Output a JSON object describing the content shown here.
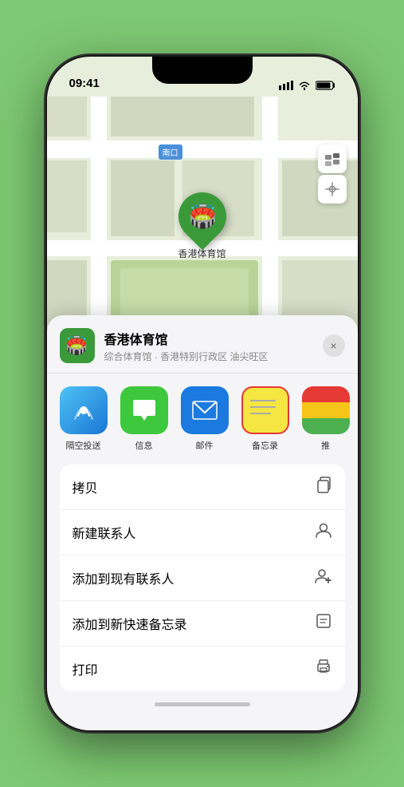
{
  "status_bar": {
    "time": "09:41",
    "signal_icon": "▌▌▌",
    "wifi_icon": "wifi",
    "battery_icon": "battery"
  },
  "map": {
    "label": "南口",
    "venue_name_on_map": "香港体育馆"
  },
  "sheet": {
    "venue_name": "香港体育馆",
    "venue_subtitle": "综合体育馆 · 香港特别行政区 油尖旺区",
    "close_label": "×"
  },
  "share_items": [
    {
      "id": "airdrop",
      "label": "隔空投送",
      "icon": "📡"
    },
    {
      "id": "messages",
      "label": "信息",
      "icon": "💬"
    },
    {
      "id": "mail",
      "label": "邮件",
      "icon": "✉️"
    },
    {
      "id": "notes",
      "label": "备忘录",
      "icon": "📝"
    },
    {
      "id": "more",
      "label": "推",
      "icon": "···"
    }
  ],
  "actions": [
    {
      "id": "copy",
      "label": "拷贝",
      "icon": "⎘"
    },
    {
      "id": "new-contact",
      "label": "新建联系人",
      "icon": "👤"
    },
    {
      "id": "add-existing",
      "label": "添加到现有联系人",
      "icon": "👤+"
    },
    {
      "id": "add-notes",
      "label": "添加到新快速备忘录",
      "icon": "🗒️"
    },
    {
      "id": "print",
      "label": "打印",
      "icon": "🖨️"
    }
  ],
  "colors": {
    "green": "#3a9a3a",
    "blue": "#1a7adf",
    "highlight_border": "#e53935",
    "bg_green": "#7dc872"
  }
}
